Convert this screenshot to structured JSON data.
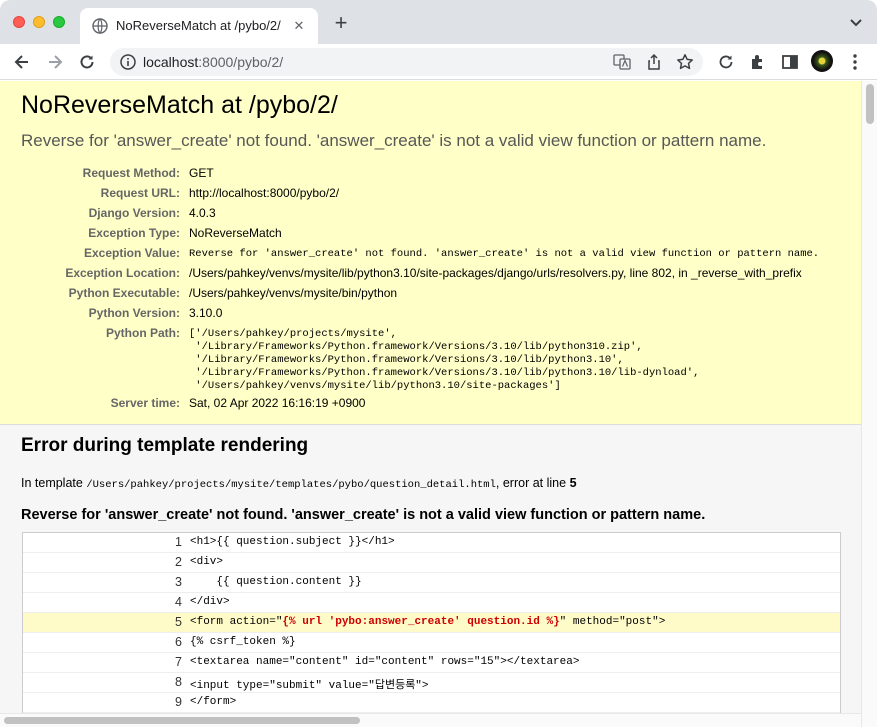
{
  "browser": {
    "tab_title": "NoReverseMatch at /pybo/2/",
    "url_host": "localhost",
    "url_rest": ":8000/pybo/2/",
    "new_tab_symbol": "+",
    "tab_close_symbol": "✕",
    "icons": [
      "globe-icon",
      "back-icon",
      "forward-icon",
      "reload-icon",
      "info-icon",
      "translate-icon",
      "share-icon",
      "bookmark-star-icon",
      "refresh-icon",
      "extensions-icon",
      "sidepanel-icon",
      "more-icon",
      "tab-search-icon"
    ]
  },
  "summary": {
    "title": "NoReverseMatch at /pybo/2/",
    "exception_message": "Reverse for 'answer_create' not found. 'answer_create' is not a valid view function or pattern name.",
    "rows": [
      {
        "key": "Request Method:",
        "value": "GET"
      },
      {
        "key": "Request URL:",
        "value": "http://localhost:8000/pybo/2/"
      },
      {
        "key": "Django Version:",
        "value": "4.0.3"
      },
      {
        "key": "Exception Type:",
        "value": "NoReverseMatch"
      },
      {
        "key": "Exception Value:",
        "value": "Reverse for 'answer_create' not found. 'answer_create' is not a valid view function or pattern name."
      },
      {
        "key": "Exception Location:",
        "value": "/Users/pahkey/venvs/mysite/lib/python3.10/site-packages/django/urls/resolvers.py, line 802, in _reverse_with_prefix"
      },
      {
        "key": "Python Executable:",
        "value": "/Users/pahkey/venvs/mysite/bin/python"
      },
      {
        "key": "Python Version:",
        "value": "3.10.0"
      },
      {
        "key": "Python Path:",
        "value": "['/Users/pahkey/projects/mysite',\n '/Library/Frameworks/Python.framework/Versions/3.10/lib/python310.zip',\n '/Library/Frameworks/Python.framework/Versions/3.10/lib/python3.10',\n '/Library/Frameworks/Python.framework/Versions/3.10/lib/python3.10/lib-dynload',\n '/Users/pahkey/venvs/mysite/lib/python3.10/site-packages']"
      },
      {
        "key": "Server time:",
        "value": "Sat, 02 Apr 2022 16:16:19 +0900"
      }
    ]
  },
  "template_error": {
    "heading": "Error during template rendering",
    "in_template_prefix": "In template",
    "template_path": "/Users/pahkey/projects/mysite/templates/pybo/question_detail.html",
    "error_at_line_text": ", error at line",
    "error_line": "5",
    "message": "Reverse for 'answer_create' not found. 'answer_create' is not a valid view function or pattern name.",
    "code_lines": [
      {
        "num": "1",
        "pre": "<h1>{{ question.subject }}</h1>",
        "err": "",
        "post": "",
        "highlight": false
      },
      {
        "num": "2",
        "pre": "<div>",
        "err": "",
        "post": "",
        "highlight": false
      },
      {
        "num": "3",
        "pre": "    {{ question.content }}",
        "err": "",
        "post": "",
        "highlight": false
      },
      {
        "num": "4",
        "pre": "</div>",
        "err": "",
        "post": "",
        "highlight": false
      },
      {
        "num": "5",
        "pre": "<form action=\"",
        "err": "{% url 'pybo:answer_create' question.id %}",
        "post": "\" method=\"post\">",
        "highlight": true
      },
      {
        "num": "6",
        "pre": "{% csrf_token %}",
        "err": "",
        "post": "",
        "highlight": false
      },
      {
        "num": "7",
        "pre": "<textarea name=\"content\" id=\"content\" rows=\"15\"></textarea>",
        "err": "",
        "post": "",
        "highlight": false
      },
      {
        "num": "8",
        "pre": "<input type=\"submit\" value=\"답변등록\">",
        "err": "",
        "post": "",
        "highlight": false
      },
      {
        "num": "9",
        "pre": "</form>",
        "err": "",
        "post": "",
        "highlight": false
      }
    ]
  }
}
